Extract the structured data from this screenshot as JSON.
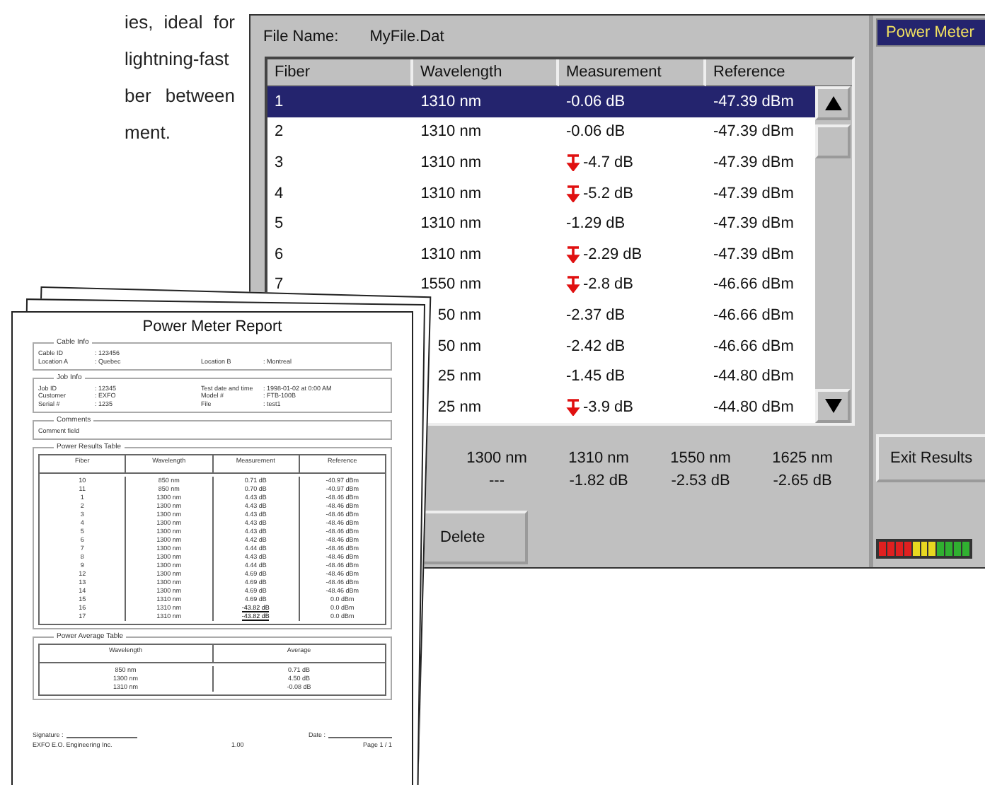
{
  "intro_text": [
    "ies, ideal for",
    "lightning-fast",
    "ber between",
    "ment."
  ],
  "screen": {
    "file_label": "File Name:",
    "file_name": "MyFile.Dat",
    "columns": [
      "Fiber",
      "Wavelength",
      "Measurement",
      "Reference"
    ],
    "rows": [
      {
        "fiber": "1",
        "wavelength": "1310 nm",
        "measurement": "-0.06 dB",
        "reference": "-47.39 dBm",
        "warning": false,
        "selected": true
      },
      {
        "fiber": "2",
        "wavelength": "1310 nm",
        "measurement": "-0.06 dB",
        "reference": "-47.39 dBm",
        "warning": false,
        "selected": false
      },
      {
        "fiber": "3",
        "wavelength": "1310 nm",
        "measurement": "-4.7 dB",
        "reference": "-47.39 dBm",
        "warning": true,
        "selected": false
      },
      {
        "fiber": "4",
        "wavelength": "1310 nm",
        "measurement": "-5.2 dB",
        "reference": "-47.39 dBm",
        "warning": true,
        "selected": false
      },
      {
        "fiber": "5",
        "wavelength": "1310 nm",
        "measurement": "-1.29 dB",
        "reference": "-47.39 dBm",
        "warning": false,
        "selected": false
      },
      {
        "fiber": "6",
        "wavelength": "1310 nm",
        "measurement": "-2.29 dB",
        "reference": "-47.39 dBm",
        "warning": true,
        "selected": false
      },
      {
        "fiber": "7",
        "wavelength": "1550 nm",
        "measurement": "-2.8 dB",
        "reference": "-46.66 dBm",
        "warning": true,
        "selected": false
      },
      {
        "wavelength": "50 nm",
        "measurement": "-2.37 dB",
        "reference": "-46.66 dBm",
        "warning": false,
        "selected": false
      },
      {
        "wavelength": "50 nm",
        "measurement": "-2.42 dB",
        "reference": "-46.66 dBm",
        "warning": false,
        "selected": false
      },
      {
        "wavelength": "25 nm",
        "measurement": "-1.45 dB",
        "reference": "-44.80 dBm",
        "warning": false,
        "selected": false
      },
      {
        "wavelength": "25 nm",
        "measurement": "-3.9 dB",
        "reference": "-44.80 dBm",
        "warning": true,
        "selected": false
      }
    ],
    "averages": [
      {
        "wavelength": "1300 nm",
        "value": "---"
      },
      {
        "wavelength": "1310 nm",
        "value": "-1.82 dB"
      },
      {
        "wavelength": "1550 nm",
        "value": "-2.53 dB"
      },
      {
        "wavelength": "1625 nm",
        "value": "-2.65 dB"
      }
    ],
    "delete_button": "Delete",
    "side_title": "Power Meter",
    "exit_button": "Exit Results"
  },
  "report": {
    "title": "Power Meter Report",
    "sections": [
      {
        "heading": "Cable Info",
        "rows": [
          [
            {
              "label": "Cable ID",
              "value": ": 123456"
            }
          ],
          [
            {
              "label": "Location A",
              "value": ": Quebec"
            },
            {
              "label": "Location B",
              "value": ": Montreal"
            }
          ]
        ]
      },
      {
        "heading": "Job Info",
        "rows": [
          [
            {
              "label": "Job ID",
              "value": ": 12345"
            },
            {
              "label": "Test date and time",
              "value": ": 1998-01-02 at 0:00 AM"
            }
          ],
          [
            {
              "label": "Customer",
              "value": ": EXFO"
            },
            {
              "label": "Model #",
              "value": ": FTB-100B"
            }
          ],
          [
            {
              "label": "Serial #",
              "value": ": 1235"
            },
            {
              "label": "File",
              "value": ": test1"
            }
          ]
        ]
      },
      {
        "heading": "Comments",
        "rows": [
          [
            {
              "label": "Comment field"
            }
          ]
        ]
      }
    ],
    "results": {
      "heading": "Power Results Table",
      "columns": [
        "Fiber",
        "Wavelength",
        "Measurement",
        "Reference"
      ],
      "rows": [
        {
          "cells": [
            "10",
            "850 nm",
            "0.71 dB",
            "-40.97 dBm"
          ],
          "flagged": false
        },
        {
          "cells": [
            "11",
            "850 nm",
            "0.70 dB",
            "-40.97 dBm"
          ],
          "flagged": false
        },
        {
          "cells": [
            "1",
            "1300 nm",
            "4.43 dB",
            "-48.46 dBm"
          ],
          "flagged": false
        },
        {
          "cells": [
            "2",
            "1300 nm",
            "4.43 dB",
            "-48.46 dBm"
          ],
          "flagged": false
        },
        {
          "cells": [
            "3",
            "1300 nm",
            "4.43 dB",
            "-48.46 dBm"
          ],
          "flagged": false
        },
        {
          "cells": [
            "4",
            "1300 nm",
            "4.43 dB",
            "-48.46 dBm"
          ],
          "flagged": false
        },
        {
          "cells": [
            "5",
            "1300 nm",
            "4.43 dB",
            "-48.46 dBm"
          ],
          "flagged": false
        },
        {
          "cells": [
            "6",
            "1300 nm",
            "4.42 dB",
            "-48.46 dBm"
          ],
          "flagged": false
        },
        {
          "cells": [
            "7",
            "1300 nm",
            "4.44 dB",
            "-48.46 dBm"
          ],
          "flagged": false
        },
        {
          "cells": [
            "8",
            "1300 nm",
            "4.43 dB",
            "-48.46 dBm"
          ],
          "flagged": false
        },
        {
          "cells": [
            "9",
            "1300 nm",
            "4.44 dB",
            "-48.46 dBm"
          ],
          "flagged": false
        },
        {
          "cells": [
            "12",
            "1300 nm",
            "4.69 dB",
            "-48.46 dBm"
          ],
          "flagged": false
        },
        {
          "cells": [
            "13",
            "1300 nm",
            "4.69 dB",
            "-48.46 dBm"
          ],
          "flagged": false
        },
        {
          "cells": [
            "14",
            "1300 nm",
            "4.69 dB",
            "-48.46 dBm"
          ],
          "flagged": false
        },
        {
          "cells": [
            "15",
            "1310 nm",
            "4.69 dB",
            "0.0 dBm"
          ],
          "flagged": false
        },
        {
          "cells": [
            "16",
            "1310 nm",
            "-43.82 dB",
            "0.0 dBm"
          ],
          "flagged": true
        },
        {
          "cells": [
            "17",
            "1310 nm",
            "-43.82 dB",
            "0.0 dBm"
          ],
          "flagged": true
        }
      ]
    },
    "average": {
      "heading": "Power Average Table",
      "columns": [
        "Wavelength",
        "Average"
      ],
      "rows": [
        [
          "850 nm",
          "0.71 dB"
        ],
        [
          "1300 nm",
          "4.50 dB"
        ],
        [
          "1310 nm",
          "-0.08 dB"
        ]
      ]
    },
    "signature_label": "Signature :",
    "date_label": "Date :",
    "footer": [
      "EXFO E.O. Engineering Inc.",
      "1.00",
      "Page 1 / 1"
    ]
  }
}
